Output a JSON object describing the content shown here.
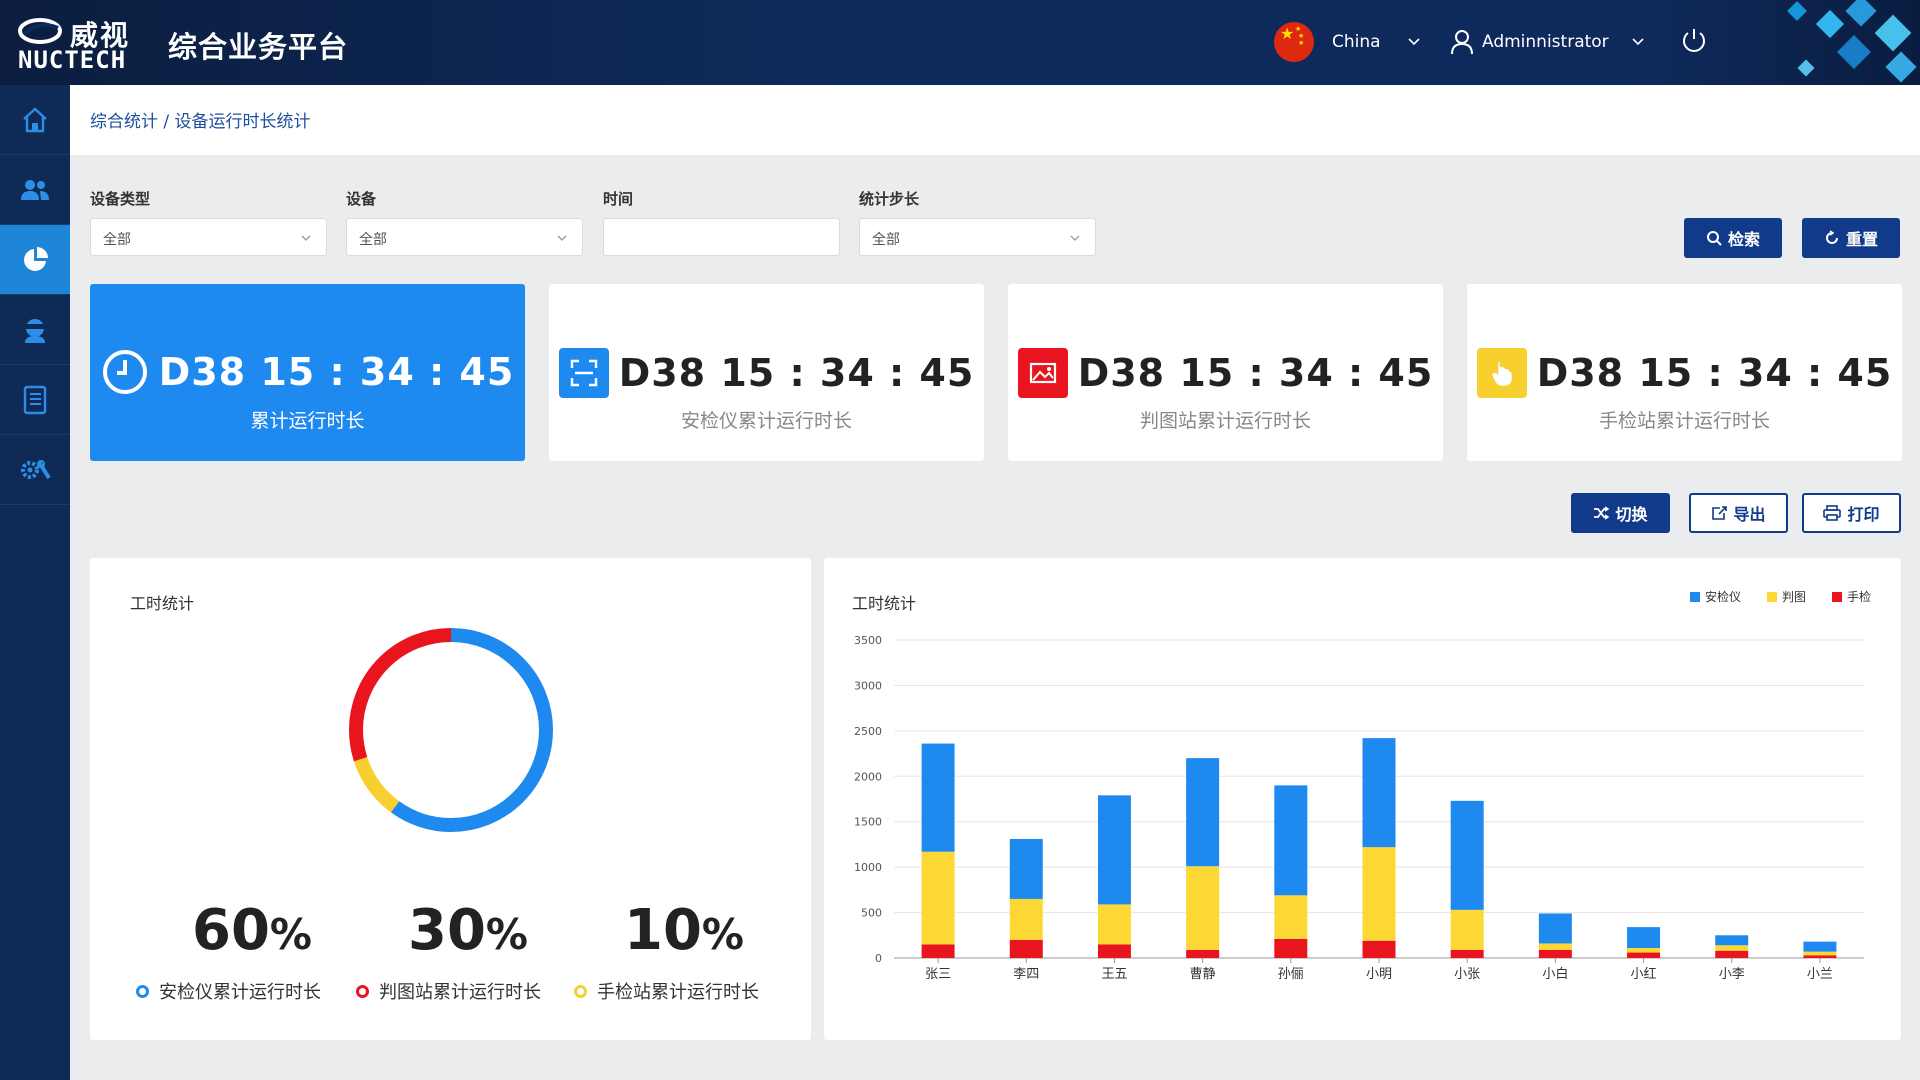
{
  "header": {
    "logo_cn": "威视",
    "logo_en": "NUCTECH",
    "title": "综合业务平台",
    "country": "China",
    "user": "Adminnistrator"
  },
  "sidebar": {
    "items": [
      {
        "icon": "home-icon"
      },
      {
        "icon": "users-icon"
      },
      {
        "icon": "pie-chart-icon",
        "active": true
      },
      {
        "icon": "inspector-icon"
      },
      {
        "icon": "book-icon"
      },
      {
        "icon": "settings-icon"
      }
    ]
  },
  "breadcrumb": "综合统计 / 设备运行时长统计",
  "filters": {
    "device_type": {
      "label": "设备类型",
      "value": "全部"
    },
    "device": {
      "label": "设备",
      "value": "全部"
    },
    "time": {
      "label": "时间",
      "value": ""
    },
    "step": {
      "label": "统计步长",
      "value": "全部"
    }
  },
  "buttons": {
    "search": "检索",
    "reset": "重置",
    "switch": "切换",
    "export": "导出",
    "print": "打印"
  },
  "cards": [
    {
      "value": "D38 15 : 34 : 45",
      "caption": "累计运行时长",
      "accent": "#1e8af0"
    },
    {
      "value": "D38  15 : 34 : 45",
      "caption": "安检仪累计运行时长",
      "accent": "#1e8af0"
    },
    {
      "value": "D38  15 : 34 : 45",
      "caption": "判图站累计运行时长",
      "accent": "#e8141e"
    },
    {
      "value": "D38  15 : 34 : 45",
      "caption": "手检站累计运行时长",
      "accent": "#f7cf2e"
    }
  ],
  "donut_panel": {
    "title": "工时统计",
    "items": [
      {
        "pct": "60",
        "label": "安检仪累计运行时长",
        "color": "#1e8af0"
      },
      {
        "pct": "30",
        "label": "判图站累计运行时长",
        "color": "#e8141e"
      },
      {
        "pct": "10",
        "label": "手检站累计运行时长",
        "color": "#f7cf2e"
      }
    ]
  },
  "chart_data": {
    "type": "bar",
    "stacked": true,
    "title": "工时统计",
    "categories": [
      "张三",
      "李四",
      "王五",
      "曹静",
      "孙俪",
      "小明",
      "小张",
      "小白",
      "小红",
      "小李",
      "小兰"
    ],
    "series": [
      {
        "name": "手检",
        "color": "#e8141e",
        "values": [
          150,
          200,
          150,
          90,
          210,
          190,
          90,
          90,
          60,
          80,
          30
        ]
      },
      {
        "name": "判图",
        "color": "#fdd835",
        "values": [
          1020,
          450,
          440,
          920,
          480,
          1030,
          440,
          70,
          50,
          60,
          40
        ]
      },
      {
        "name": "安检仪",
        "color": "#1e8af0",
        "values": [
          1190,
          660,
          1200,
          1190,
          1210,
          1200,
          1200,
          330,
          230,
          110,
          110
        ]
      }
    ],
    "legend": [
      "安检仪",
      "判图",
      "手检"
    ],
    "legend_position": "top-right",
    "ylim": [
      0,
      3500
    ],
    "yticks": [
      0,
      500,
      1000,
      1500,
      2000,
      2500,
      3000,
      3500
    ],
    "grid": true
  }
}
